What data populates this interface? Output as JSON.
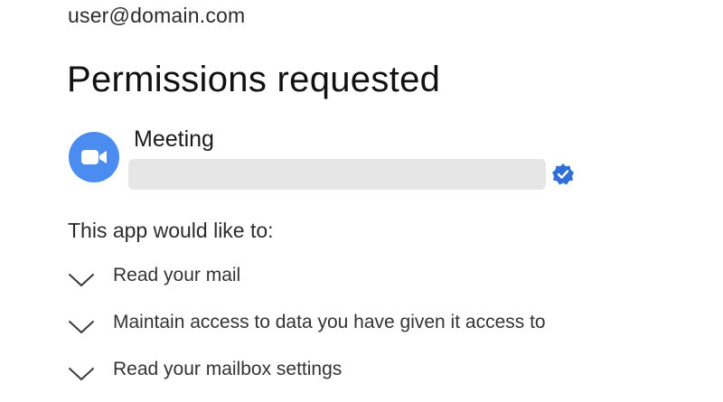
{
  "account": {
    "email": "user@domain.com"
  },
  "header": {
    "title": "Permissions requested"
  },
  "app": {
    "name": "Meeting",
    "icon": "video-camera-icon",
    "icon_color": "#4a8cf0",
    "verified_icon": "verified-badge-icon",
    "verified_color": "#2f6fd6"
  },
  "permissions": {
    "intro": "This app would like to:",
    "items": [
      {
        "label": "Read your mail",
        "icon": "chevron-down-icon"
      },
      {
        "label": "Maintain access to data you have given it access to",
        "icon": "chevron-down-icon"
      },
      {
        "label": "Read your mailbox settings",
        "icon": "chevron-down-icon"
      }
    ]
  }
}
